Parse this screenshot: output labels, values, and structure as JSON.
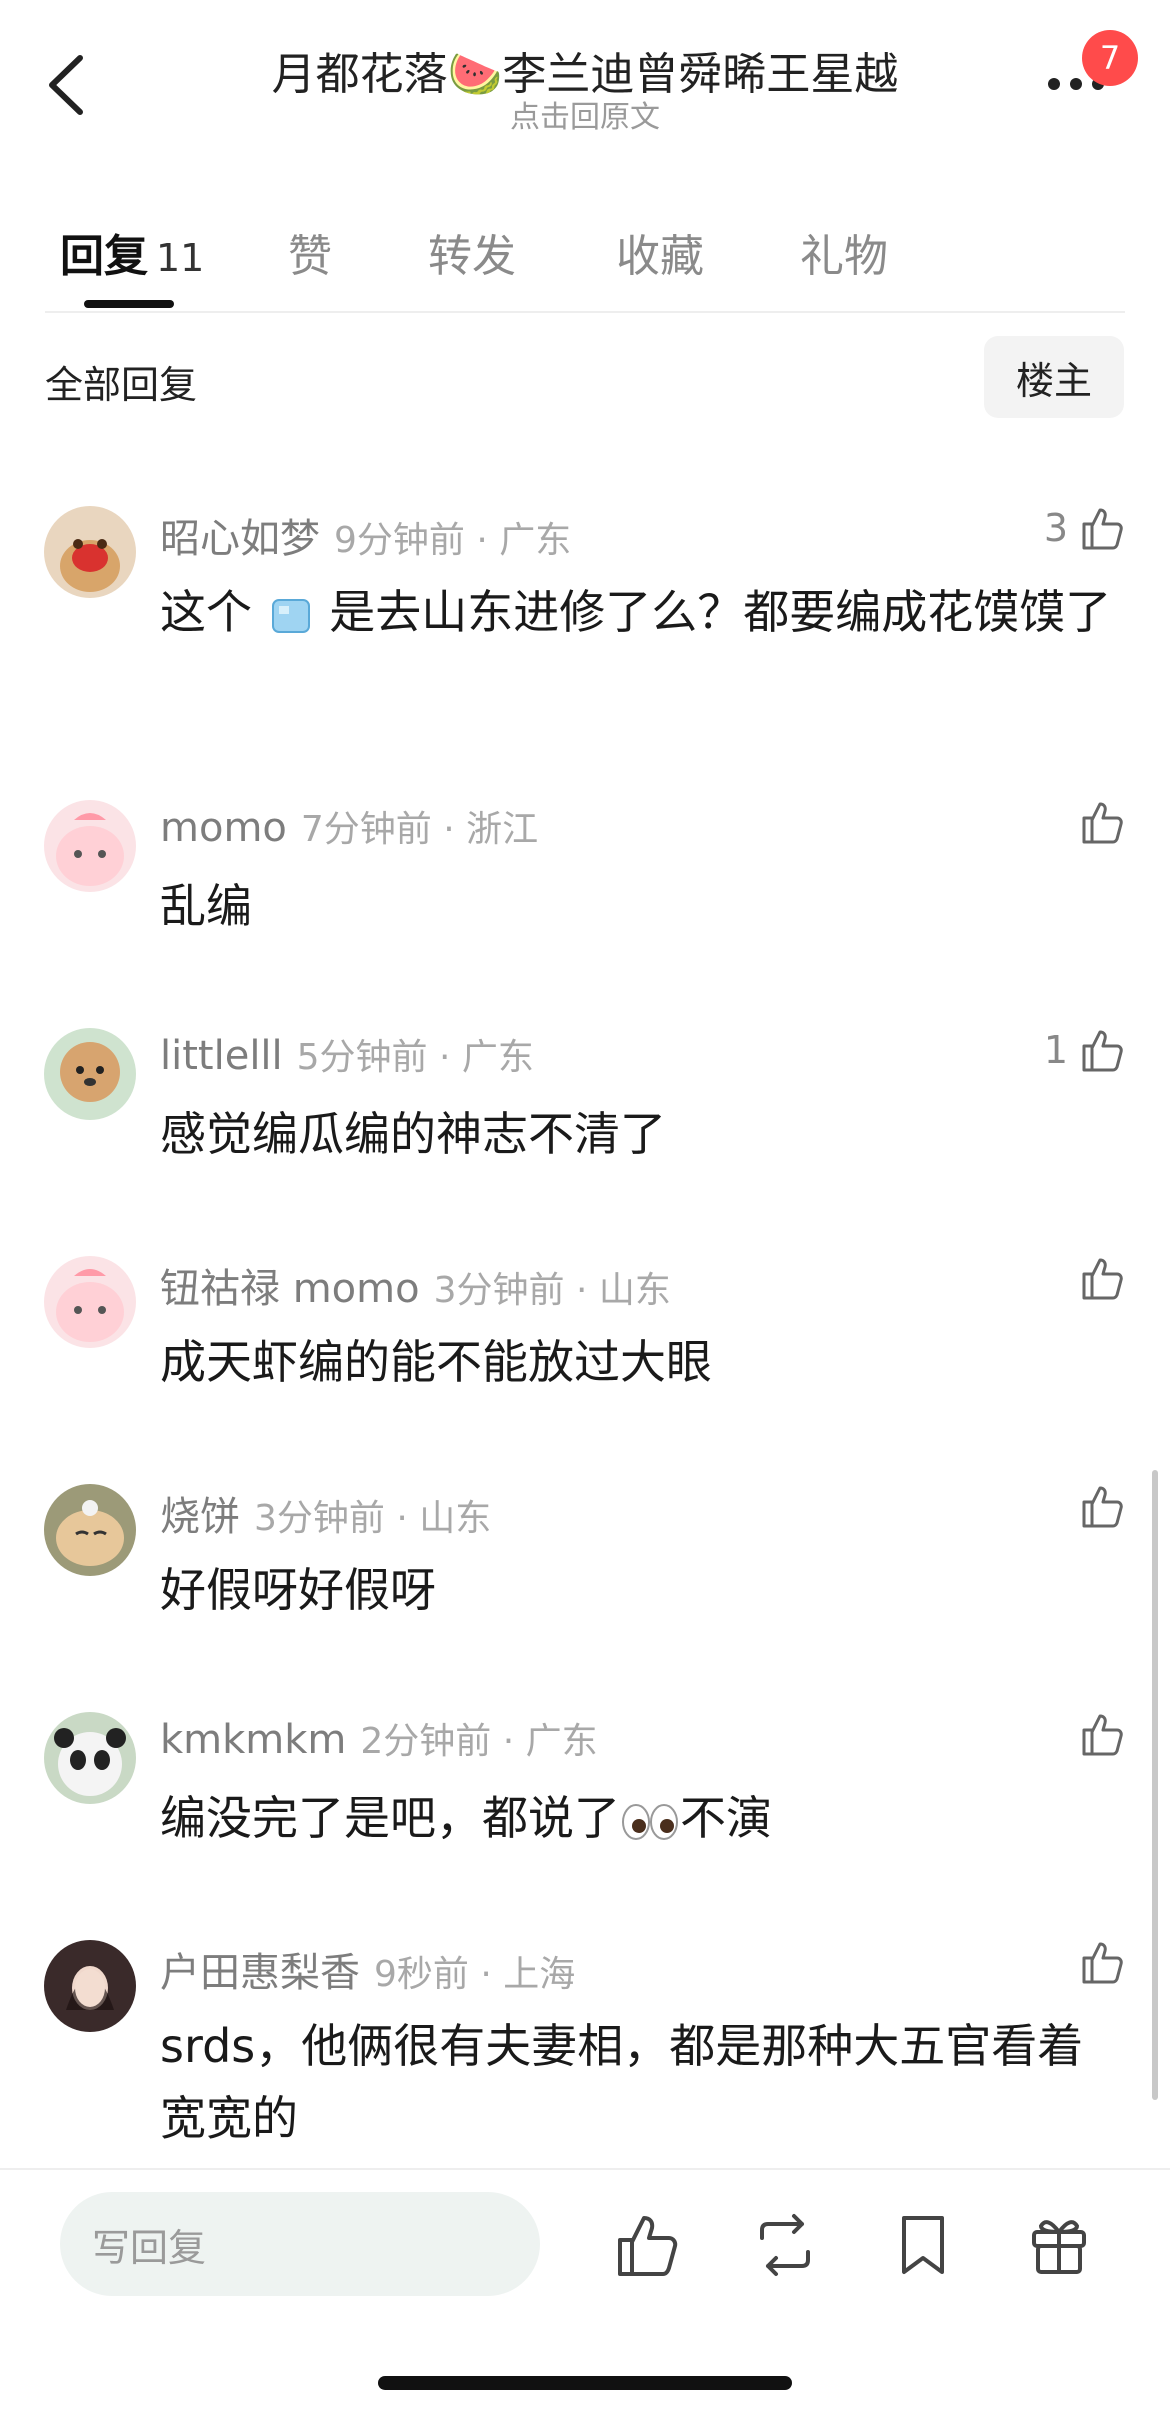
{
  "header": {
    "title": "月都花落🍉李兰迪曾舜晞王星越",
    "subtitle": "点击回原文",
    "badge": "7"
  },
  "tabs": [
    {
      "label": "回复",
      "count": "11",
      "active": true
    },
    {
      "label": "赞"
    },
    {
      "label": "转发"
    },
    {
      "label": "收藏"
    },
    {
      "label": "礼物"
    }
  ],
  "section": {
    "title": "全部回复",
    "op_button": "楼主"
  },
  "comments": [
    {
      "name": "昭心如梦",
      "time": "9分钟前 · 广东",
      "likes": "3",
      "text_before": "这个",
      "icon": "ice-cube-emoji",
      "text_after": "是去山东进修了么？都要编成花馍馍了"
    },
    {
      "name": "momo",
      "time": "7分钟前 · 浙江",
      "likes": "",
      "text": "乱编"
    },
    {
      "name": "littlelll",
      "time": "5分钟前 · 广东",
      "likes": "1",
      "text": "感觉编瓜编的神志不清了"
    },
    {
      "name": "钮祜禄 momo",
      "time": "3分钟前 · 山东",
      "likes": "",
      "text": "成天虾编的能不能放过大眼"
    },
    {
      "name": "烧饼",
      "time": "3分钟前 · 山东",
      "likes": "",
      "text": "好假呀好假呀"
    },
    {
      "name": "kmkmkm",
      "time": "2分钟前 · 广东",
      "likes": "",
      "text_before": "编没完了是吧，都说了",
      "icon": "eyes-emoji",
      "text_after": "不演"
    },
    {
      "name": "户田惠梨香",
      "time": "9秒前 · 上海",
      "likes": "",
      "text": "srds，他俩很有夫妻相，都是那种大五官看着宽宽的"
    }
  ],
  "bottom": {
    "reply_placeholder": "写回复"
  }
}
